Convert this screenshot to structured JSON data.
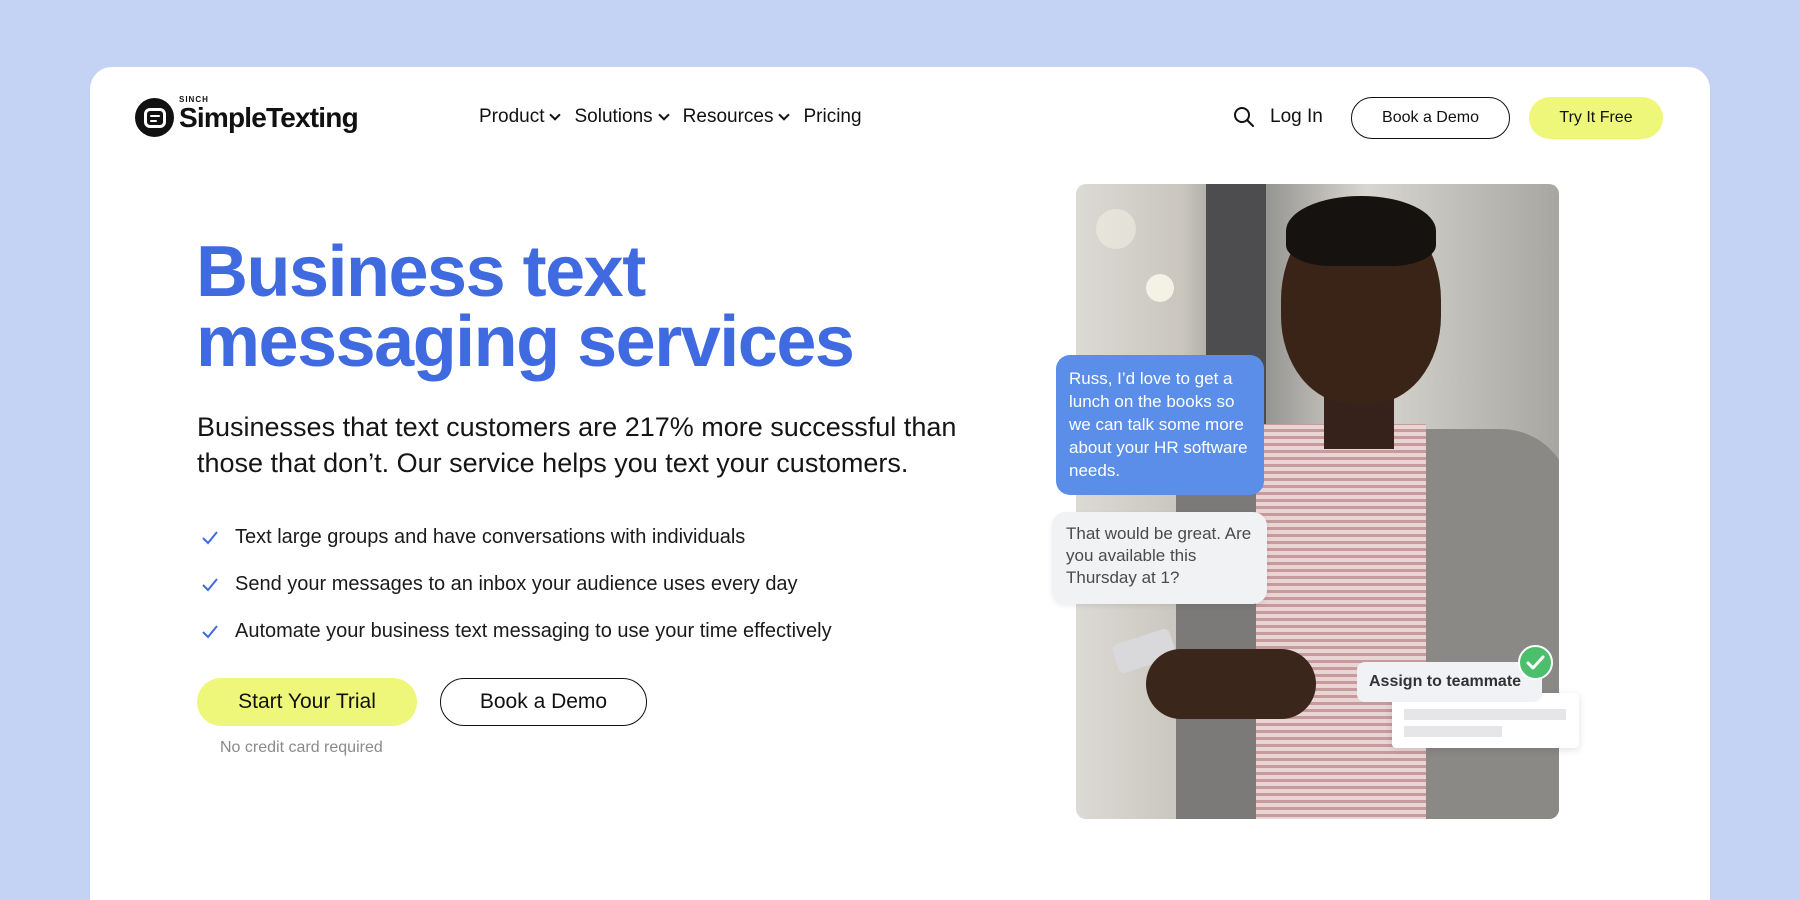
{
  "brand": {
    "tag": "SINCH",
    "name": "SimpleTexting"
  },
  "nav": {
    "items": [
      {
        "label": "Product",
        "has_dropdown": true
      },
      {
        "label": "Solutions",
        "has_dropdown": true
      },
      {
        "label": "Resources",
        "has_dropdown": true
      },
      {
        "label": "Pricing",
        "has_dropdown": false
      }
    ],
    "search_icon": "search-icon",
    "login_label": "Log In",
    "demo_label": "Book a Demo",
    "try_label": "Try It Free"
  },
  "hero": {
    "title_line1": "Business text",
    "title_line2": "messaging services",
    "subtitle": "Businesses that text customers are 217% more successful than those that don’t. Our service helps you text your customers.",
    "features": [
      "Text large groups and have conversations with individuals",
      "Send your messages to an inbox your audience uses every day",
      "Automate your business text messaging to use your time effectively"
    ],
    "primary_cta": "Start Your Trial",
    "secondary_cta": "Book a Demo",
    "note": "No credit card required"
  },
  "illustration": {
    "outgoing_message": "Russ, I’d love to get a lunch on the books so we can talk some more about your HR software needs.",
    "incoming_message": "That would be great. Are you available this Thursday at 1?",
    "assign_label": "Assign to teammate"
  },
  "colors": {
    "background": "#c4d3f4",
    "accent_blue": "#3f6ae0",
    "cta_yellow": "#eef779",
    "bubble_blue": "#5b8ee8",
    "success_green": "#4bbf6b"
  }
}
